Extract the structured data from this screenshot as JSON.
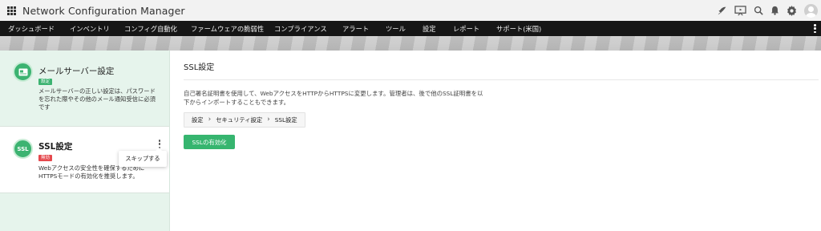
{
  "app": {
    "title": "Network Configuration Manager"
  },
  "topbar": {
    "icons": [
      "rocket-icon",
      "presentation-icon",
      "search-icon",
      "bell-icon",
      "gear-icon",
      "user-avatar-icon"
    ]
  },
  "nav": {
    "items": [
      {
        "label": "ダッシュボード"
      },
      {
        "label": "インベントリ"
      },
      {
        "label": "コンフィグ自動化"
      },
      {
        "label": "ファームウェアの脆弱性"
      },
      {
        "label": "コンプライアンス"
      },
      {
        "label": "アラート"
      },
      {
        "label": "ツール"
      },
      {
        "label": "設定"
      },
      {
        "label": "レポート"
      },
      {
        "label": "サポート(米国)"
      }
    ]
  },
  "sidebar": {
    "cards": [
      {
        "title": "メールサーバー設定",
        "badge": "設定",
        "badge_color": "#3cb371",
        "description": "メールサーバーの正しい設定は、パスワードを忘れた際やその他のメール通知受信に必須です"
      },
      {
        "title": "SSL設定",
        "icon_text": "SSL",
        "badge": "無効",
        "badge_color": "#e5484d",
        "description": "Webアクセスの安全性を確保するために HTTPSモードの有効化を推奨します。"
      }
    ],
    "tooltip": "スキップする"
  },
  "main": {
    "title": "SSL設定",
    "description": "自己署名証明書を使用して、WebアクセスをHTTPからHTTPSに変更します。管理者は、後で他のSSL証明書を以下からインポートすることもできます。",
    "breadcrumb": [
      "設定",
      "セキュリティ設定",
      "SSL設定"
    ],
    "enable_button": "SSLの有効化"
  },
  "colors": {
    "accent": "#36b56f",
    "nav_bg": "#161616",
    "panel_bg": "#e6f4ec",
    "disabled_badge": "#e5484d"
  }
}
